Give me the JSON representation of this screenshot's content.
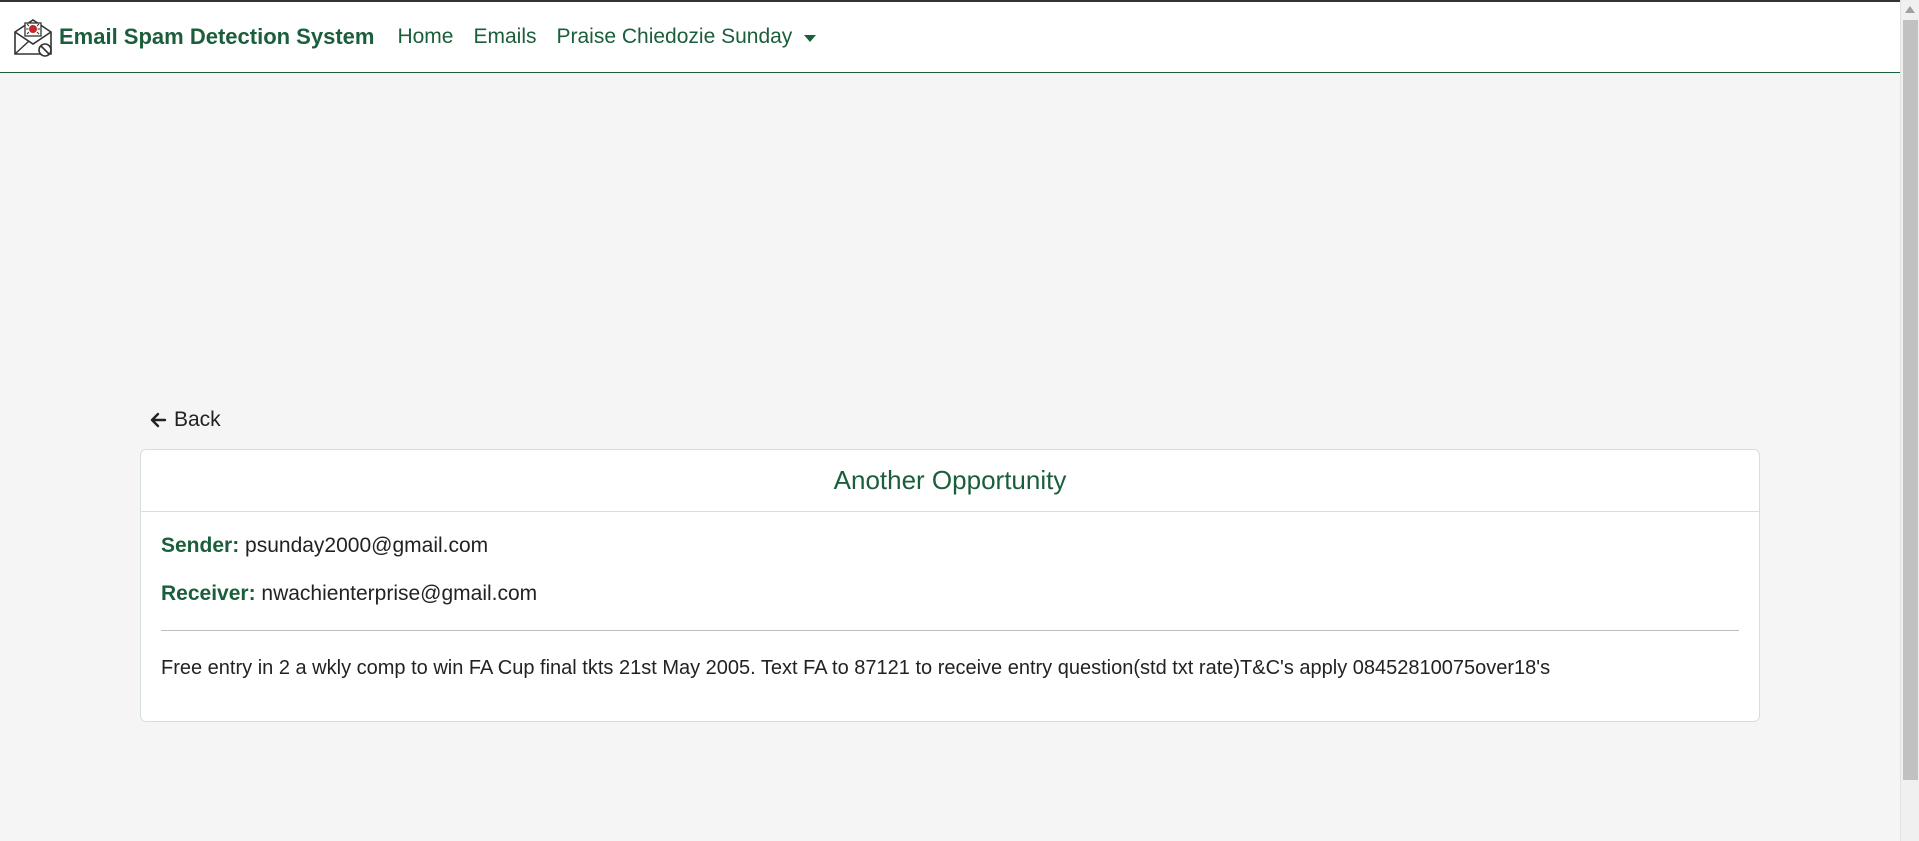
{
  "navbar": {
    "brand": "Email Spam Detection System",
    "brand_logo_icon": "spam-envelope-icon",
    "links": [
      {
        "label": "Home"
      },
      {
        "label": "Emails"
      },
      {
        "label": "Praise Chiedozie Sunday"
      }
    ],
    "accent_color": "#1b5e3b"
  },
  "back": {
    "label": "Back",
    "icon": "arrow-left-icon"
  },
  "email": {
    "subject": "Another Opportunity",
    "sender_label": "Sender:",
    "sender": "psunday2000@gmail.com",
    "receiver_label": "Receiver:",
    "receiver": "nwachienterprise@gmail.com",
    "body": "Free entry in 2 a wkly comp to win FA Cup final tkts 21st May 2005. Text FA to 87121 to receive entry question(std txt rate)T&C's apply 08452810075over18's"
  }
}
